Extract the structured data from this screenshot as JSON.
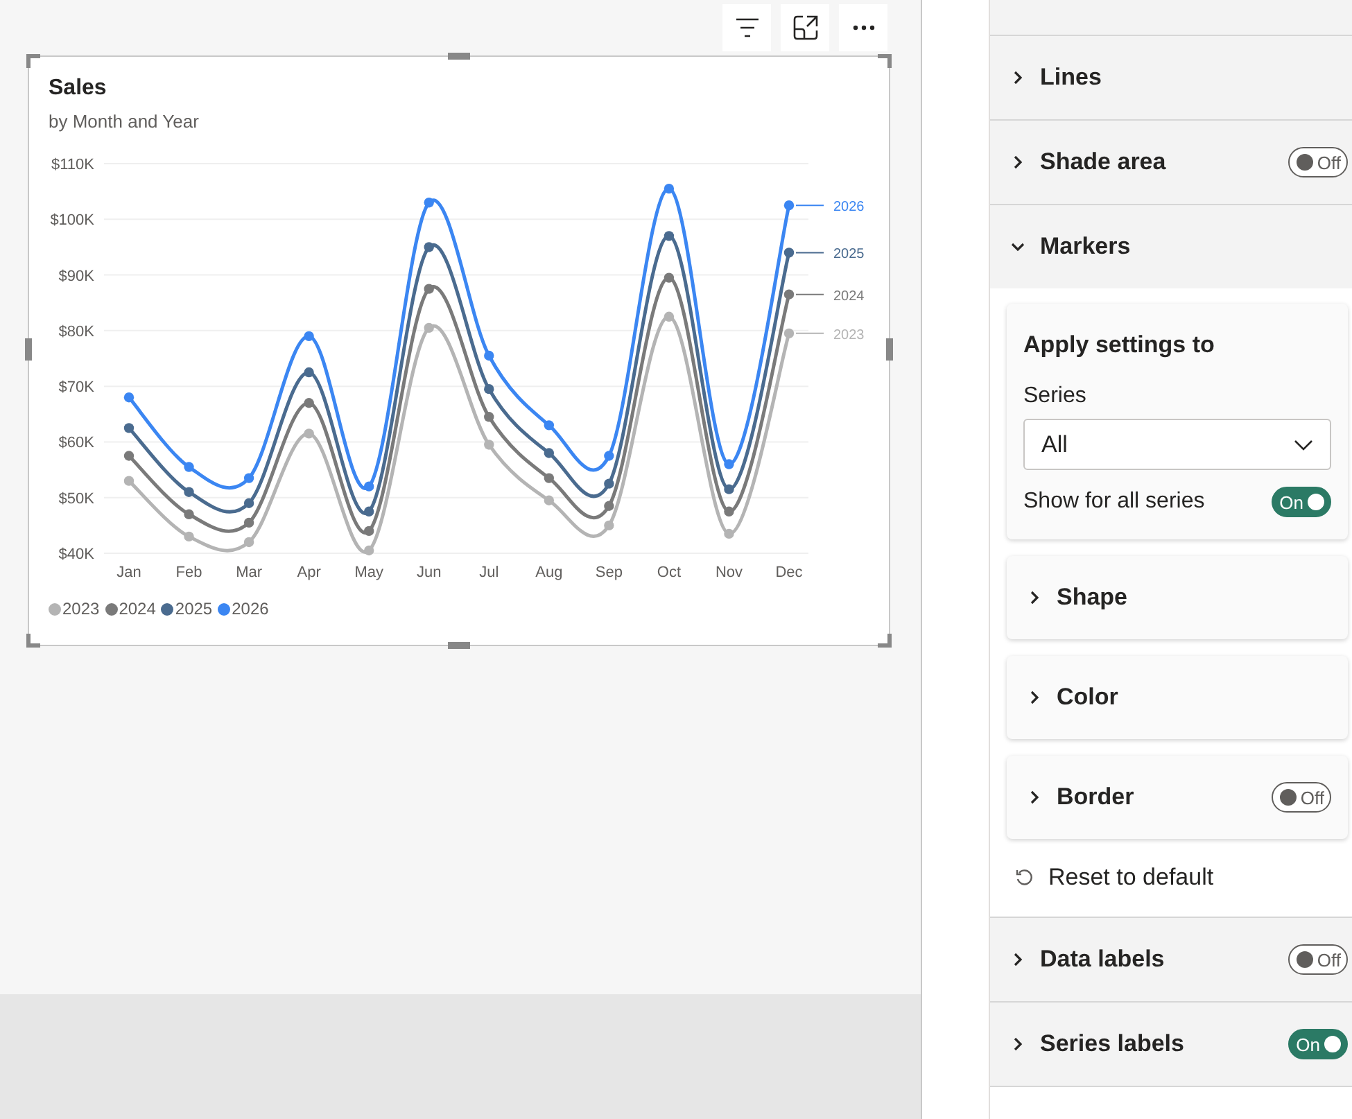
{
  "visual_toolbar": {
    "buttons": [
      {
        "kind": "filter"
      },
      {
        "kind": "focus"
      },
      {
        "kind": "more"
      }
    ]
  },
  "visual": {
    "title": "Sales",
    "subtitle": "by Month and Year",
    "chart_data": {
      "type": "line",
      "categories": [
        "Jan",
        "Feb",
        "Mar",
        "Apr",
        "May",
        "Jun",
        "Jul",
        "Aug",
        "Sep",
        "Oct",
        "Nov",
        "Dec"
      ],
      "series": [
        {
          "name": "2023",
          "color": "#b4b4b4",
          "marker": "circle",
          "values": [
            53,
            43,
            42,
            61.5,
            40.5,
            80.5,
            59.5,
            49.5,
            45,
            82.5,
            43.5,
            79.5
          ]
        },
        {
          "name": "2024",
          "color": "#7a7a7a",
          "marker": "circle",
          "values": [
            57.5,
            47,
            45.5,
            67,
            44,
            87.5,
            64.5,
            53.5,
            48.5,
            89.5,
            47.5,
            86.5
          ]
        },
        {
          "name": "2025",
          "color": "#4a6b8f",
          "marker": "circle",
          "values": [
            62.5,
            51,
            49,
            72.5,
            47.5,
            95,
            69.5,
            58,
            52.5,
            97,
            51.5,
            94
          ]
        },
        {
          "name": "2026",
          "color": "#3b86f2",
          "marker": "circle",
          "values": [
            68,
            55.5,
            53.5,
            79,
            52,
            103,
            75.5,
            63,
            57.5,
            105.5,
            56,
            102.5
          ]
        }
      ],
      "ylim": [
        40,
        110
      ],
      "grid": true,
      "legend": true,
      "yticks": [
        {
          "value": 40,
          "label": "$40K"
        },
        {
          "value": 50,
          "label": "$50K"
        },
        {
          "value": 60,
          "label": "$60K"
        },
        {
          "value": 70,
          "label": "$70K"
        },
        {
          "value": 80,
          "label": "$80K"
        },
        {
          "value": 90,
          "label": "$90K"
        },
        {
          "value": 100,
          "label": "$100K"
        },
        {
          "value": 110,
          "label": "$110K"
        }
      ]
    },
    "series_end_labels": [
      "2026",
      "2025",
      "2024",
      "2023"
    ]
  },
  "format_pane": {
    "sections": [
      {
        "label": "Lines",
        "expanded": false
      },
      {
        "label": "Shade area",
        "expanded": false,
        "toggle": {
          "on": false,
          "label": "Off"
        }
      },
      {
        "label": "Markers",
        "expanded": true
      },
      {
        "label": "Data labels",
        "expanded": false,
        "toggle": {
          "on": false,
          "label": "Off"
        }
      },
      {
        "label": "Series labels",
        "expanded": false,
        "toggle": {
          "on": true,
          "label": "On"
        }
      }
    ],
    "markers": {
      "apply_title": "Apply settings to",
      "series_label": "Series",
      "series_value": "All",
      "show_all": {
        "label": "Show for all series",
        "toggle": {
          "on": true,
          "label": "On"
        }
      },
      "cards": [
        {
          "label": "Shape",
          "expanded": false
        },
        {
          "label": "Color",
          "expanded": false
        },
        {
          "label": "Border",
          "expanded": false,
          "toggle": {
            "on": false,
            "label": "Off"
          }
        }
      ],
      "reset": "Reset to default"
    }
  }
}
